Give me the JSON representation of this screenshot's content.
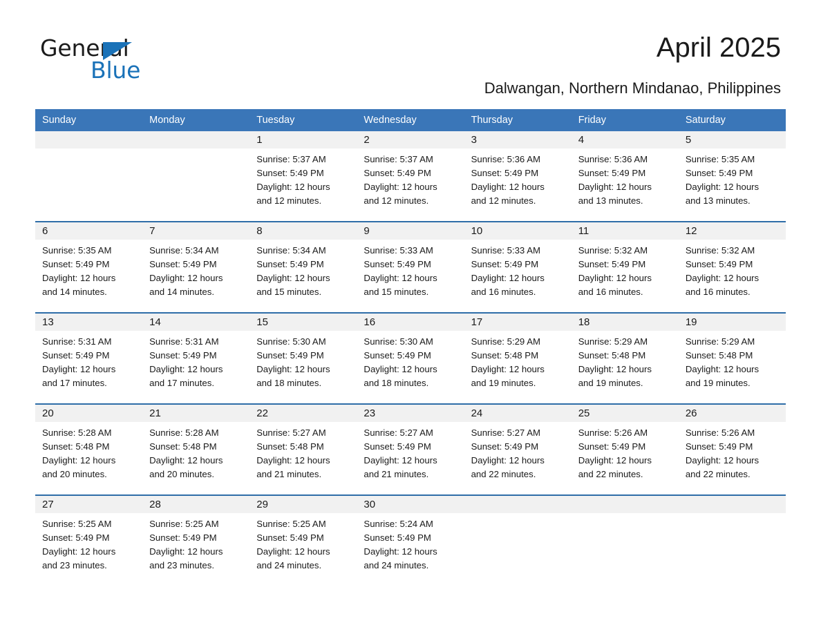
{
  "brand": {
    "name_part1": "General",
    "name_part2": "Blue",
    "accent_color": "#1a72b8"
  },
  "header": {
    "title": "April 2025",
    "location": "Dalwangan, Northern Mindanao, Philippines"
  },
  "calendar": {
    "header_bg": "#3a76b8",
    "row_rule_color": "#2e6da8",
    "daynum_bg": "#f1f1f1",
    "weekday_headers": [
      "Sunday",
      "Monday",
      "Tuesday",
      "Wednesday",
      "Thursday",
      "Friday",
      "Saturday"
    ],
    "weeks": [
      [
        {
          "day": "",
          "sunrise": "",
          "sunset": "",
          "daylight1": "",
          "daylight2": ""
        },
        {
          "day": "",
          "sunrise": "",
          "sunset": "",
          "daylight1": "",
          "daylight2": ""
        },
        {
          "day": "1",
          "sunrise": "Sunrise: 5:37 AM",
          "sunset": "Sunset: 5:49 PM",
          "daylight1": "Daylight: 12 hours",
          "daylight2": "and 12 minutes."
        },
        {
          "day": "2",
          "sunrise": "Sunrise: 5:37 AM",
          "sunset": "Sunset: 5:49 PM",
          "daylight1": "Daylight: 12 hours",
          "daylight2": "and 12 minutes."
        },
        {
          "day": "3",
          "sunrise": "Sunrise: 5:36 AM",
          "sunset": "Sunset: 5:49 PM",
          "daylight1": "Daylight: 12 hours",
          "daylight2": "and 12 minutes."
        },
        {
          "day": "4",
          "sunrise": "Sunrise: 5:36 AM",
          "sunset": "Sunset: 5:49 PM",
          "daylight1": "Daylight: 12 hours",
          "daylight2": "and 13 minutes."
        },
        {
          "day": "5",
          "sunrise": "Sunrise: 5:35 AM",
          "sunset": "Sunset: 5:49 PM",
          "daylight1": "Daylight: 12 hours",
          "daylight2": "and 13 minutes."
        }
      ],
      [
        {
          "day": "6",
          "sunrise": "Sunrise: 5:35 AM",
          "sunset": "Sunset: 5:49 PM",
          "daylight1": "Daylight: 12 hours",
          "daylight2": "and 14 minutes."
        },
        {
          "day": "7",
          "sunrise": "Sunrise: 5:34 AM",
          "sunset": "Sunset: 5:49 PM",
          "daylight1": "Daylight: 12 hours",
          "daylight2": "and 14 minutes."
        },
        {
          "day": "8",
          "sunrise": "Sunrise: 5:34 AM",
          "sunset": "Sunset: 5:49 PM",
          "daylight1": "Daylight: 12 hours",
          "daylight2": "and 15 minutes."
        },
        {
          "day": "9",
          "sunrise": "Sunrise: 5:33 AM",
          "sunset": "Sunset: 5:49 PM",
          "daylight1": "Daylight: 12 hours",
          "daylight2": "and 15 minutes."
        },
        {
          "day": "10",
          "sunrise": "Sunrise: 5:33 AM",
          "sunset": "Sunset: 5:49 PM",
          "daylight1": "Daylight: 12 hours",
          "daylight2": "and 16 minutes."
        },
        {
          "day": "11",
          "sunrise": "Sunrise: 5:32 AM",
          "sunset": "Sunset: 5:49 PM",
          "daylight1": "Daylight: 12 hours",
          "daylight2": "and 16 minutes."
        },
        {
          "day": "12",
          "sunrise": "Sunrise: 5:32 AM",
          "sunset": "Sunset: 5:49 PM",
          "daylight1": "Daylight: 12 hours",
          "daylight2": "and 16 minutes."
        }
      ],
      [
        {
          "day": "13",
          "sunrise": "Sunrise: 5:31 AM",
          "sunset": "Sunset: 5:49 PM",
          "daylight1": "Daylight: 12 hours",
          "daylight2": "and 17 minutes."
        },
        {
          "day": "14",
          "sunrise": "Sunrise: 5:31 AM",
          "sunset": "Sunset: 5:49 PM",
          "daylight1": "Daylight: 12 hours",
          "daylight2": "and 17 minutes."
        },
        {
          "day": "15",
          "sunrise": "Sunrise: 5:30 AM",
          "sunset": "Sunset: 5:49 PM",
          "daylight1": "Daylight: 12 hours",
          "daylight2": "and 18 minutes."
        },
        {
          "day": "16",
          "sunrise": "Sunrise: 5:30 AM",
          "sunset": "Sunset: 5:49 PM",
          "daylight1": "Daylight: 12 hours",
          "daylight2": "and 18 minutes."
        },
        {
          "day": "17",
          "sunrise": "Sunrise: 5:29 AM",
          "sunset": "Sunset: 5:48 PM",
          "daylight1": "Daylight: 12 hours",
          "daylight2": "and 19 minutes."
        },
        {
          "day": "18",
          "sunrise": "Sunrise: 5:29 AM",
          "sunset": "Sunset: 5:48 PM",
          "daylight1": "Daylight: 12 hours",
          "daylight2": "and 19 minutes."
        },
        {
          "day": "19",
          "sunrise": "Sunrise: 5:29 AM",
          "sunset": "Sunset: 5:48 PM",
          "daylight1": "Daylight: 12 hours",
          "daylight2": "and 19 minutes."
        }
      ],
      [
        {
          "day": "20",
          "sunrise": "Sunrise: 5:28 AM",
          "sunset": "Sunset: 5:48 PM",
          "daylight1": "Daylight: 12 hours",
          "daylight2": "and 20 minutes."
        },
        {
          "day": "21",
          "sunrise": "Sunrise: 5:28 AM",
          "sunset": "Sunset: 5:48 PM",
          "daylight1": "Daylight: 12 hours",
          "daylight2": "and 20 minutes."
        },
        {
          "day": "22",
          "sunrise": "Sunrise: 5:27 AM",
          "sunset": "Sunset: 5:48 PM",
          "daylight1": "Daylight: 12 hours",
          "daylight2": "and 21 minutes."
        },
        {
          "day": "23",
          "sunrise": "Sunrise: 5:27 AM",
          "sunset": "Sunset: 5:49 PM",
          "daylight1": "Daylight: 12 hours",
          "daylight2": "and 21 minutes."
        },
        {
          "day": "24",
          "sunrise": "Sunrise: 5:27 AM",
          "sunset": "Sunset: 5:49 PM",
          "daylight1": "Daylight: 12 hours",
          "daylight2": "and 22 minutes."
        },
        {
          "day": "25",
          "sunrise": "Sunrise: 5:26 AM",
          "sunset": "Sunset: 5:49 PM",
          "daylight1": "Daylight: 12 hours",
          "daylight2": "and 22 minutes."
        },
        {
          "day": "26",
          "sunrise": "Sunrise: 5:26 AM",
          "sunset": "Sunset: 5:49 PM",
          "daylight1": "Daylight: 12 hours",
          "daylight2": "and 22 minutes."
        }
      ],
      [
        {
          "day": "27",
          "sunrise": "Sunrise: 5:25 AM",
          "sunset": "Sunset: 5:49 PM",
          "daylight1": "Daylight: 12 hours",
          "daylight2": "and 23 minutes."
        },
        {
          "day": "28",
          "sunrise": "Sunrise: 5:25 AM",
          "sunset": "Sunset: 5:49 PM",
          "daylight1": "Daylight: 12 hours",
          "daylight2": "and 23 minutes."
        },
        {
          "day": "29",
          "sunrise": "Sunrise: 5:25 AM",
          "sunset": "Sunset: 5:49 PM",
          "daylight1": "Daylight: 12 hours",
          "daylight2": "and 24 minutes."
        },
        {
          "day": "30",
          "sunrise": "Sunrise: 5:24 AM",
          "sunset": "Sunset: 5:49 PM",
          "daylight1": "Daylight: 12 hours",
          "daylight2": "and 24 minutes."
        },
        {
          "day": "",
          "sunrise": "",
          "sunset": "",
          "daylight1": "",
          "daylight2": ""
        },
        {
          "day": "",
          "sunrise": "",
          "sunset": "",
          "daylight1": "",
          "daylight2": ""
        },
        {
          "day": "",
          "sunrise": "",
          "sunset": "",
          "daylight1": "",
          "daylight2": ""
        }
      ]
    ]
  }
}
